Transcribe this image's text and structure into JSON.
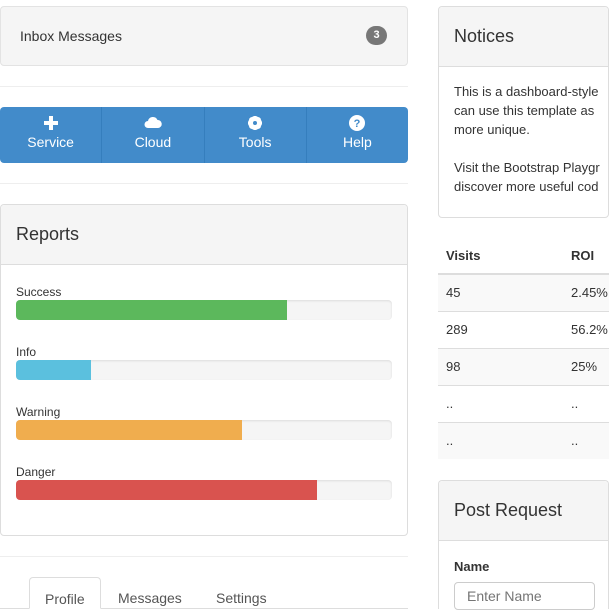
{
  "inbox": {
    "label": "Inbox Messages",
    "count": "3"
  },
  "buttons": [
    {
      "label": "Service",
      "icon": "plus-icon"
    },
    {
      "label": "Cloud",
      "icon": "cloud-icon"
    },
    {
      "label": "Tools",
      "icon": "gear-icon"
    },
    {
      "label": "Help",
      "icon": "question-icon"
    }
  ],
  "reports": {
    "title": "Reports",
    "bars": [
      {
        "label": "Success",
        "percent": 72,
        "color": "#5cb85c"
      },
      {
        "label": "Info",
        "percent": 20,
        "color": "#5bc0de"
      },
      {
        "label": "Warning",
        "percent": 60,
        "color": "#f0ad4e"
      },
      {
        "label": "Danger",
        "percent": 80,
        "color": "#d9534f"
      }
    ]
  },
  "tabs": [
    "Profile",
    "Messages",
    "Settings"
  ],
  "notices": {
    "title": "Notices",
    "lines": [
      "This is a dashboard-style",
      "can use this template as",
      "more unique.",
      "",
      "Visit the Bootstrap Playgr",
      "discover more useful cod"
    ]
  },
  "table": {
    "headers": [
      "Visits",
      "ROI"
    ],
    "rows": [
      [
        "45",
        "2.45%"
      ],
      [
        "289",
        "56.2%"
      ],
      [
        "98",
        "25%"
      ],
      [
        "..",
        ".."
      ],
      [
        "..",
        ".."
      ]
    ]
  },
  "post": {
    "title": "Post Request",
    "name_label": "Name",
    "name_placeholder": "Enter Name"
  }
}
